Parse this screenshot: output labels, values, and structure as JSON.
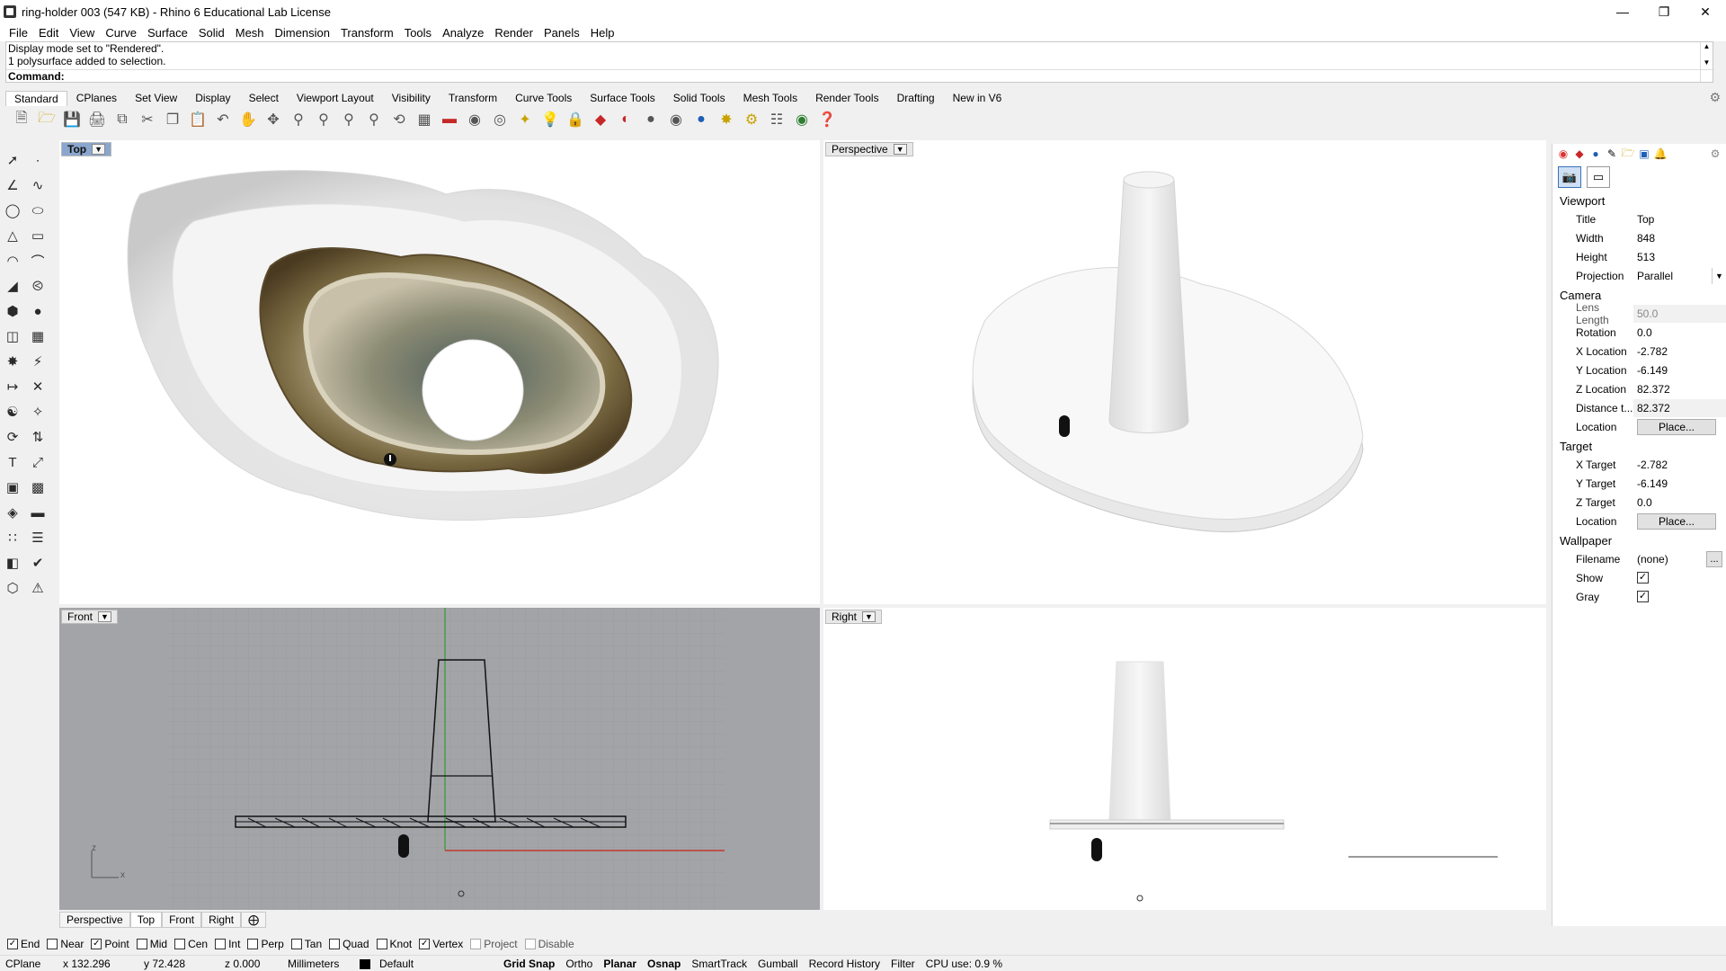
{
  "window": {
    "title": "ring-holder 003 (547 KB) - Rhino 6 Educational Lab License"
  },
  "menu": [
    "File",
    "Edit",
    "View",
    "Curve",
    "Surface",
    "Solid",
    "Mesh",
    "Dimension",
    "Transform",
    "Tools",
    "Analyze",
    "Render",
    "Panels",
    "Help"
  ],
  "command": {
    "history": [
      "Display mode set to \"Rendered\".",
      "1 polysurface added to selection."
    ],
    "prompt": "Command:",
    "value": ""
  },
  "toolbar_tabs": [
    "Standard",
    "CPlanes",
    "Set View",
    "Display",
    "Select",
    "Viewport Layout",
    "Visibility",
    "Transform",
    "Curve Tools",
    "Surface Tools",
    "Solid Tools",
    "Mesh Tools",
    "Render Tools",
    "Drafting",
    "New in V6"
  ],
  "toolbar_icons": [
    "new-icon",
    "open-icon",
    "save-icon",
    "print-icon",
    "import-icon",
    "cut-icon",
    "copy-icon",
    "paste-icon",
    "undo-icon",
    "pan-icon",
    "rotate-icon",
    "zoom-icon",
    "zoom-window-icon",
    "zoom-extents-icon",
    "zoom-selected-icon",
    "undo-view-icon",
    "four-viewports-icon",
    "car-icon",
    "osnap-icon",
    "cplane-icon",
    "lights-icon",
    "bulb-icon",
    "lock-icon",
    "materials-icon",
    "render-color-icon",
    "sphere-icon",
    "render-icon",
    "blue-sphere-icon",
    "wand-icon",
    "settings-icon",
    "network-icon",
    "globe-icon",
    "help-icon"
  ],
  "viewports": {
    "top": {
      "label": "Top"
    },
    "perspective": {
      "label": "Perspective"
    },
    "front": {
      "label": "Front",
      "axis_z": "z",
      "axis_x": "x"
    },
    "right": {
      "label": "Right"
    }
  },
  "viewport_tabs": [
    "Perspective",
    "Top",
    "Front",
    "Right"
  ],
  "osnap": [
    {
      "label": "End",
      "checked": true,
      "enabled": true
    },
    {
      "label": "Near",
      "checked": false,
      "enabled": true
    },
    {
      "label": "Point",
      "checked": true,
      "enabled": true
    },
    {
      "label": "Mid",
      "checked": false,
      "enabled": true
    },
    {
      "label": "Cen",
      "checked": false,
      "enabled": true
    },
    {
      "label": "Int",
      "checked": false,
      "enabled": true
    },
    {
      "label": "Perp",
      "checked": false,
      "enabled": true
    },
    {
      "label": "Tan",
      "checked": false,
      "enabled": true
    },
    {
      "label": "Quad",
      "checked": false,
      "enabled": true
    },
    {
      "label": "Knot",
      "checked": false,
      "enabled": true
    },
    {
      "label": "Vertex",
      "checked": true,
      "enabled": true
    },
    {
      "label": "Project",
      "checked": false,
      "enabled": false
    },
    {
      "label": "Disable",
      "checked": false,
      "enabled": false
    }
  ],
  "status": {
    "cplane": "CPlane",
    "x": "x 132.296",
    "y": "y 72.428",
    "z": "z 0.000",
    "units": "Millimeters",
    "layer": "Default",
    "grid_snap": "Grid Snap",
    "ortho": "Ortho",
    "planar": "Planar",
    "osnap": "Osnap",
    "smarttrack": "SmartTrack",
    "gumball": "Gumball",
    "record_history": "Record History",
    "filter": "Filter",
    "cpu": "CPU use: 0.9 %"
  },
  "properties": {
    "viewport_header": "Viewport",
    "title_label": "Title",
    "title_value": "Top",
    "width_label": "Width",
    "width_value": "848",
    "height_label": "Height",
    "height_value": "513",
    "projection_label": "Projection",
    "projection_value": "Parallel",
    "camera_header": "Camera",
    "lens_label": "Lens Length",
    "lens_value": "50.0",
    "rotation_label": "Rotation",
    "rotation_value": "0.0",
    "xloc_label": "X Location",
    "xloc_value": "-2.782",
    "yloc_label": "Y Location",
    "yloc_value": "-6.149",
    "zloc_label": "Z Location",
    "zloc_value": "82.372",
    "dist_label": "Distance t...",
    "dist_value": "82.372",
    "location_label": "Location",
    "place_button": "Place...",
    "target_header": "Target",
    "xt_label": "X Target",
    "xt_value": "-2.782",
    "yt_label": "Y Target",
    "yt_value": "-6.149",
    "zt_label": "Z Target",
    "zt_value": "0.0",
    "tloc_label": "Location",
    "tplace_button": "Place...",
    "wallpaper_header": "Wallpaper",
    "filename_label": "Filename",
    "filename_value": "(none)",
    "ellipsis": "...",
    "show_label": "Show",
    "gray_label": "Gray"
  }
}
